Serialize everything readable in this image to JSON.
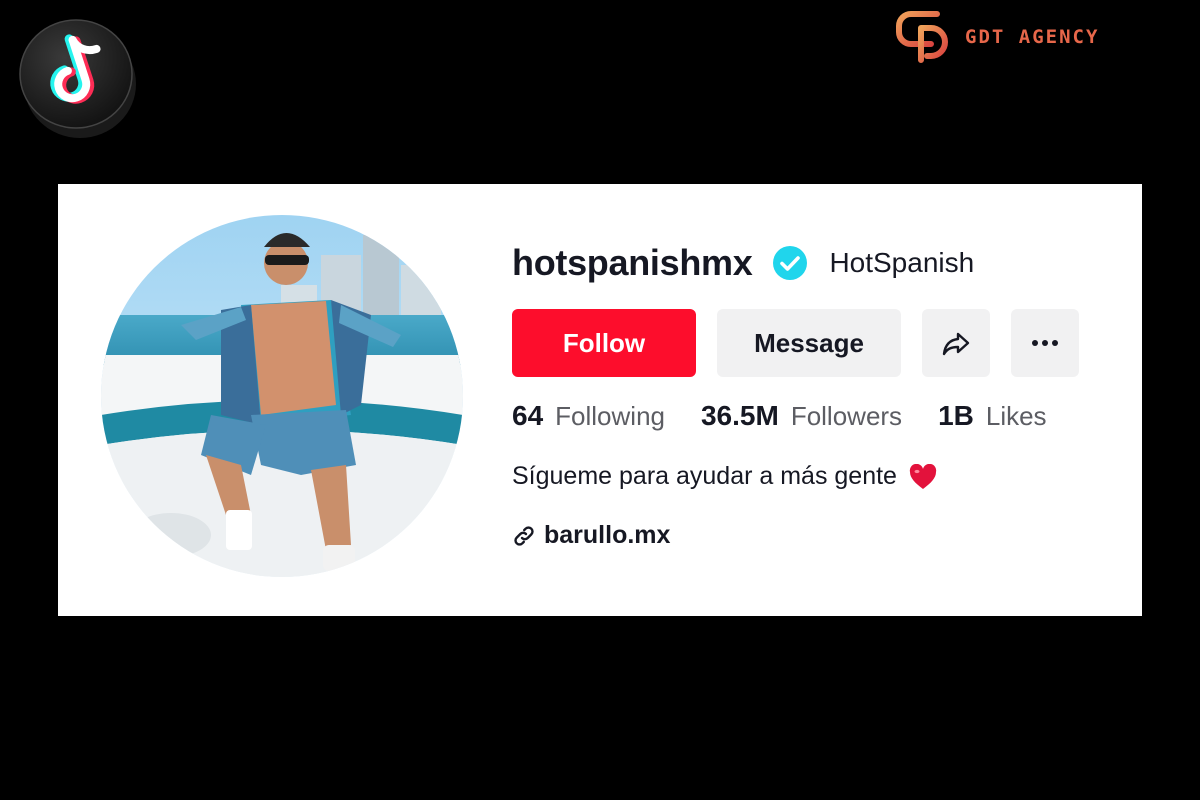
{
  "profile": {
    "username": "hotspanishmx",
    "display_name": "HotSpanish",
    "verified": true
  },
  "buttons": {
    "follow_label": "Follow",
    "message_label": "Message",
    "share_icon": "share-arrow-icon",
    "more_icon": "more-dots-icon"
  },
  "stats": {
    "following_count": "64",
    "following_label": "Following",
    "followers_count": "36.5M",
    "followers_label": "Followers",
    "likes_count": "1B",
    "likes_label": "Likes"
  },
  "bio": {
    "text": "Sígueme para ayudar a más gente"
  },
  "link": {
    "text": "barullo.mx"
  },
  "branding": {
    "agency_name": "GDT AGENCY",
    "agency_color": "#e7674a",
    "follow_color": "#fd0d2c",
    "verified_color": "#20d5ec"
  }
}
